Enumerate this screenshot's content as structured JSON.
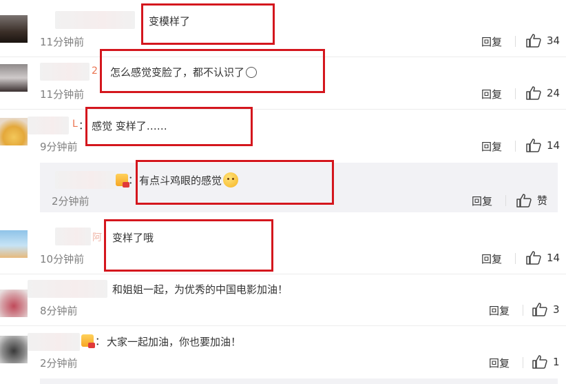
{
  "comments": [
    {
      "name_tail": "",
      "text": "变模样了",
      "time": "11分钟前",
      "reply": "回复",
      "likes": "34"
    },
    {
      "name_tail": "2",
      "text": "怎么感觉变脸了，都不认识了",
      "time": "11分钟前",
      "reply": "回复",
      "likes": "24"
    },
    {
      "name_tail": "L",
      "text": "感觉 变样了……",
      "time": "9分钟前",
      "reply": "回复",
      "likes": "14"
    },
    {
      "name_tail": "阿",
      "text": "变样了哦",
      "time": "10分钟前",
      "reply": "回复",
      "likes": "14"
    },
    {
      "name_tail": "",
      "text": "和姐姐一起，为优秀的中国电影加油！",
      "time": "8分钟前",
      "reply": "回复",
      "likes": "3"
    },
    {
      "name_tail": "",
      "text": "大家一起加油，你也要加油！",
      "time": "2分钟前",
      "reply": "回复",
      "likes": "1"
    }
  ],
  "sub_reply": {
    "text": "有点斗鸡眼的感觉",
    "time": "2分钟前",
    "reply": "回复",
    "like_label": "赞"
  },
  "colon": "：",
  "icons": {
    "like": "thumbs-up-icon",
    "badge": "member-badge-icon",
    "emoji": "smiley-emoji-icon"
  },
  "colors": {
    "highlight_box": "#d4161d",
    "username_accent": "#eb7350",
    "subreply_bg": "#f2f2f5"
  }
}
